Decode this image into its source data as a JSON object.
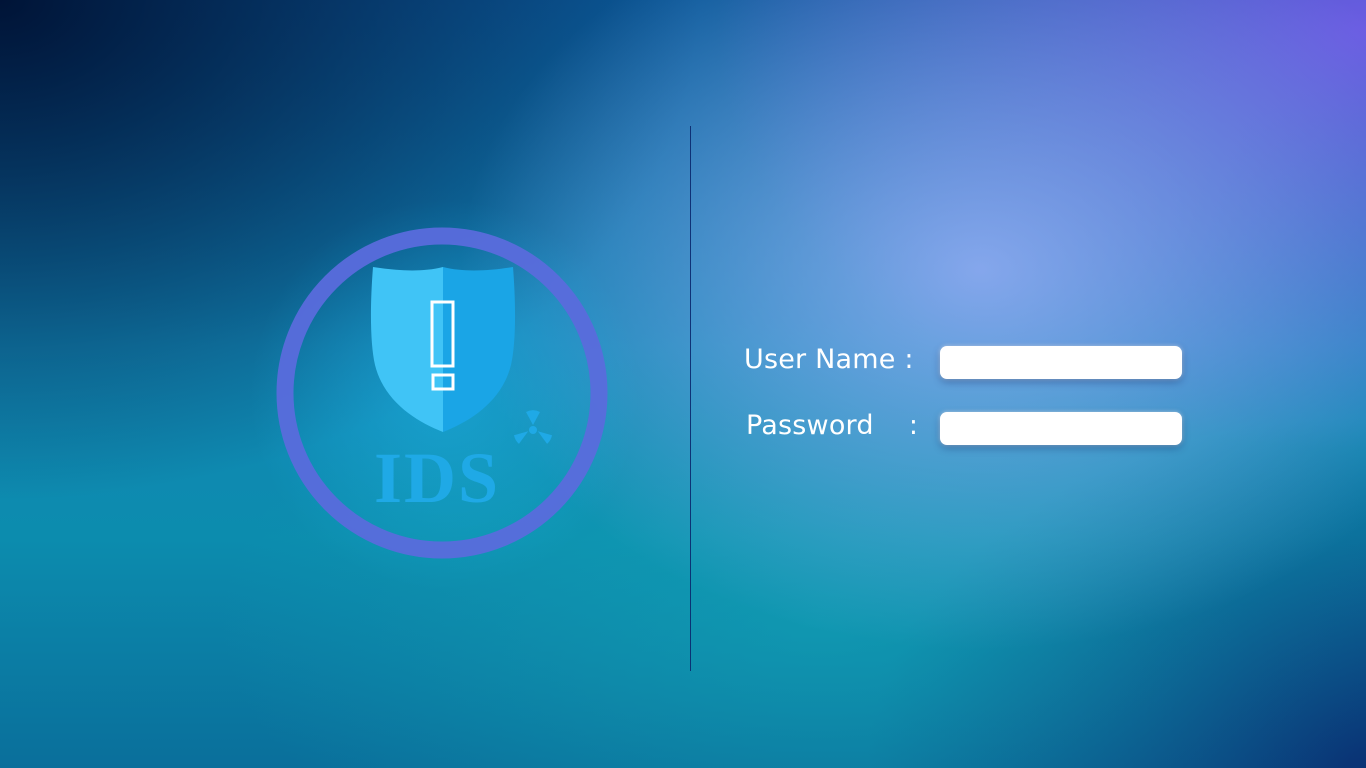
{
  "logo": {
    "text": "IDS",
    "icon": "shield-exclamation-icon",
    "decoration_icon": "radiation-icon",
    "colors": {
      "ring": "#5a6cdc",
      "shield_light": "#3cc0f5",
      "shield_dark": "#1aa2e4",
      "text": "#1fa9e6"
    }
  },
  "login": {
    "username_label": "User Name :",
    "username_value": "",
    "password_label": "Password    :",
    "password_value": ""
  }
}
